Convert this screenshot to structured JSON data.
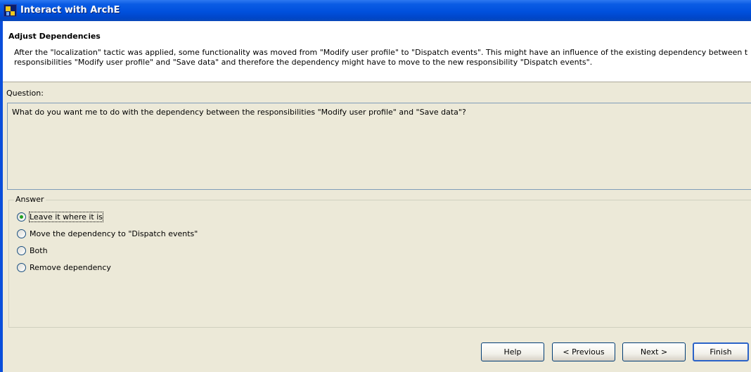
{
  "window": {
    "title": "Interact with ArchE"
  },
  "header": {
    "title": "Adjust Dependencies",
    "description_line1": "After the \"localization\" tactic was applied, some functionality was moved from \"Modify user profile\" to \"Dispatch events\". This might have an influence of the existing dependency between t",
    "description_line2": "responsibilities \"Modify user profile\" and \"Save data\" and therefore the dependency might have to move to the new responsibility \"Dispatch events\"."
  },
  "question": {
    "label": "Question:",
    "text": "What do you want me to do with the dependency between the responsibilities \"Modify user profile\" and \"Save data\"?"
  },
  "answer": {
    "legend": "Answer",
    "selected_index": 0,
    "options": [
      {
        "label": "Leave it where it is",
        "selected": true
      },
      {
        "label": "Move the dependency to \"Dispatch events\"",
        "selected": false
      },
      {
        "label": "Both",
        "selected": false
      },
      {
        "label": "Remove dependency",
        "selected": false
      }
    ]
  },
  "buttons": {
    "help": "Help",
    "previous": "< Previous",
    "next": "Next >",
    "finish": "Finish"
  },
  "colors": {
    "titlebar": "#0050DD",
    "dialog_background": "#ECE9D8",
    "radio_selected": "#21A121"
  }
}
